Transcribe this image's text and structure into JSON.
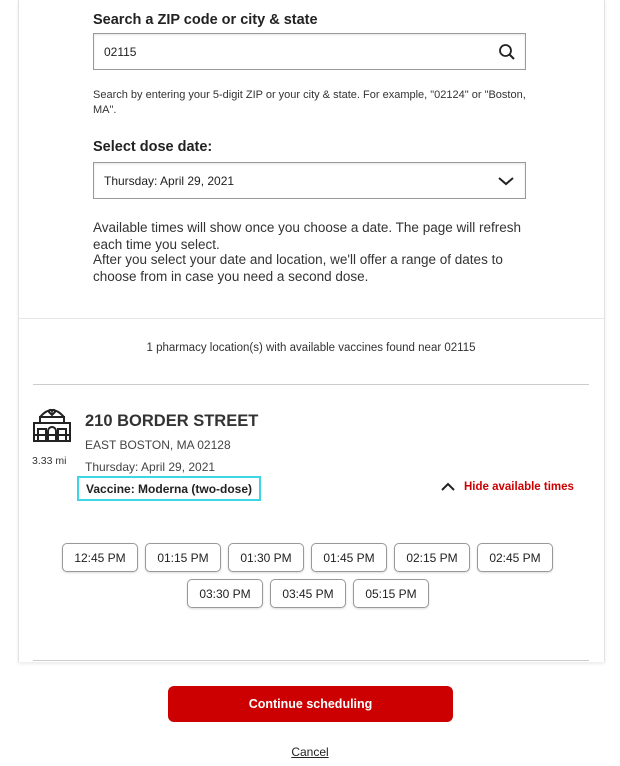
{
  "search": {
    "label": "Search a ZIP code or city & state",
    "value": "02115",
    "help": "Search by entering your 5-digit ZIP or your city & state. For example, \"02124\" or \"Boston, MA\"."
  },
  "dose": {
    "label": "Select dose date:",
    "value": "Thursday: April 29, 2021",
    "info1": "Available times will show once you choose a date. The page will refresh each time you select.",
    "info2": "After you select your date and location, we'll offer a range of dates to choose from in case you need a second dose."
  },
  "results": {
    "summary": "1 pharmacy location(s) with available vaccines found near 02115"
  },
  "location": {
    "distance": "3.33 mi",
    "name": "210 BORDER STREET",
    "city": "EAST BOSTON, MA 02128",
    "date": "Thursday: April 29, 2021",
    "vaccine": "Vaccine: Moderna (two-dose)",
    "toggle": "Hide available times",
    "times": [
      "12:45 PM",
      "01:15 PM",
      "01:30 PM",
      "01:45 PM",
      "02:15 PM",
      "02:45 PM",
      "03:30 PM",
      "03:45 PM",
      "05:15 PM"
    ]
  },
  "actions": {
    "continue": "Continue scheduling",
    "cancel": "Cancel"
  },
  "colors": {
    "accent": "#cc0000",
    "highlight": "#3dd6e6"
  }
}
